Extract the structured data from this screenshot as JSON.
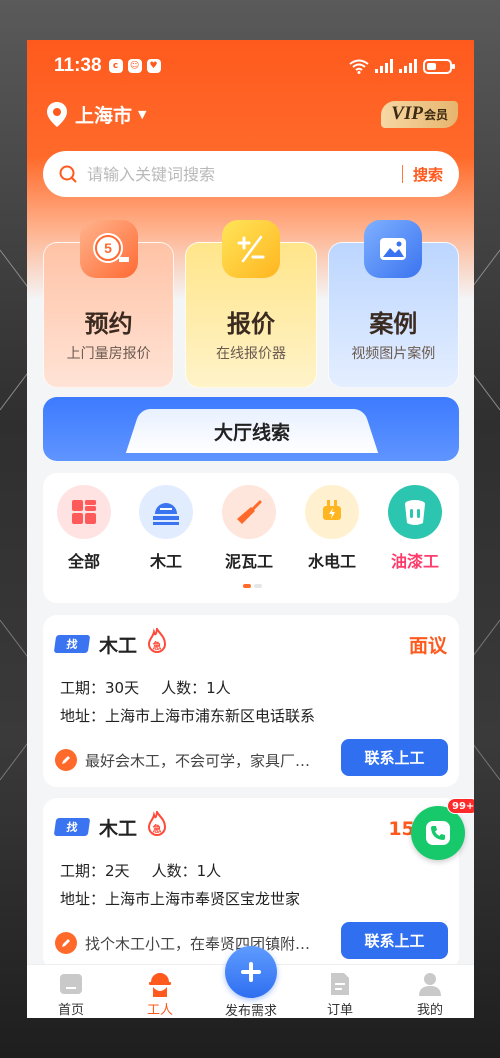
{
  "status_bar": {
    "time": "11:38"
  },
  "header": {
    "city": "上海市",
    "vip_main": "VIP",
    "vip_sub": "会员"
  },
  "search": {
    "placeholder": "请输入关键词搜索",
    "button": "搜索"
  },
  "features": [
    {
      "title": "预约",
      "subtitle": "上门量房报价",
      "icon": "tape-measure-icon",
      "icon_text": "5"
    },
    {
      "title": "报价",
      "subtitle": "在线报价器",
      "icon": "calculator-icon"
    },
    {
      "title": "案例",
      "subtitle": "视频图片案例",
      "icon": "image-icon"
    }
  ],
  "hall": {
    "title": "大厅线索"
  },
  "categories": [
    {
      "label": "全部",
      "icon": "grid-icon",
      "color": "#ff5a5a"
    },
    {
      "label": "木工",
      "icon": "saw-icon",
      "color": "#3a74f0"
    },
    {
      "label": "泥瓦工",
      "icon": "trowel-icon",
      "color": "#ff6a2a"
    },
    {
      "label": "水电工",
      "icon": "plug-icon",
      "color": "#ffb51f"
    },
    {
      "label": "油漆工",
      "icon": "paint-bucket-icon",
      "color": "#17c2a8",
      "active": true
    }
  ],
  "jobs": [
    {
      "tag": "找",
      "title": "木工",
      "price": "面议",
      "period_label": "工期：",
      "period": "30天",
      "count_label": "人数：",
      "count": "1人",
      "address_label": "地址：",
      "address": "上海市上海市浦东新区电话联系",
      "desc": "最好会木工，不会可学，家具厂…",
      "contact": "联系上工"
    },
    {
      "tag": "找",
      "title": "木工",
      "price": "150元",
      "period_label": "工期：",
      "period": "2天",
      "count_label": "人数：",
      "count": "1人",
      "address_label": "地址：",
      "address": "上海市上海市奉贤区宝龙世家",
      "desc": "找个木工小工，在奉贤四团镇附…",
      "contact": "联系上工"
    }
  ],
  "call_badge": "99+",
  "tabbar": {
    "home": "首页",
    "worker": "工人",
    "post": "发布需求",
    "orders": "订单",
    "mine": "我的",
    "active": "worker"
  },
  "colors": {
    "brand": "#ff5a1e",
    "blue": "#2f6ff0",
    "green": "#17c96a"
  }
}
